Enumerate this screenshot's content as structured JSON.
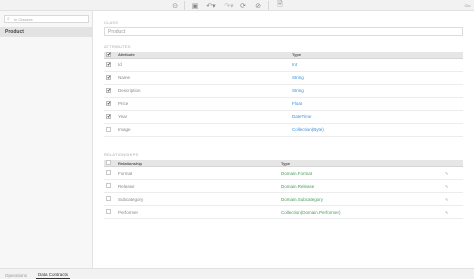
{
  "toolbar": {
    "buttons": [
      {
        "name": "refresh-icon",
        "glyph": "⊙"
      },
      {
        "name": "save-icon",
        "glyph": "▣"
      },
      {
        "name": "undo-icon",
        "glyph": "↶▾"
      },
      {
        "name": "redo-icon",
        "glyph": "↷▾"
      },
      {
        "name": "sync-icon",
        "glyph": "⟳"
      },
      {
        "name": "check-icon",
        "glyph": "⊘"
      },
      {
        "name": "document-icon",
        "glyph": "🗎"
      }
    ],
    "corner_label": "Clo"
  },
  "sidebar": {
    "filter_placeholder": "In Classes",
    "items": [
      {
        "label": "Product"
      }
    ]
  },
  "main": {
    "class_label": "CLASS",
    "class_name": "Product",
    "attributes_label": "ATTRIBUTES",
    "attributes_headers": [
      "Attribute",
      "Type"
    ],
    "attributes": [
      {
        "checked": true,
        "name": "Id",
        "type": "Int"
      },
      {
        "checked": true,
        "name": "Name",
        "type": "String"
      },
      {
        "checked": true,
        "name": "Description",
        "type": "String"
      },
      {
        "checked": true,
        "name": "Price",
        "type": "Float"
      },
      {
        "checked": true,
        "name": "Year",
        "type": "DateTime"
      },
      {
        "checked": false,
        "name": "Image",
        "type": "Collection(Byte)"
      }
    ],
    "relationships_label": "RELATIONSHIPS",
    "relationships_headers": [
      "Relationship",
      "Type"
    ],
    "relationships": [
      {
        "checked": false,
        "name": "Format",
        "type": "Domain.Format"
      },
      {
        "checked": false,
        "name": "Release",
        "type": "Domain.Release"
      },
      {
        "checked": false,
        "name": "Subcategory",
        "type": "Domain.Subcategory"
      },
      {
        "checked": false,
        "name": "Performer",
        "type": "Collection(Domain.Performer)"
      }
    ]
  },
  "bottom_tabs": [
    {
      "label": "Operations",
      "active": false
    },
    {
      "label": "Data Contracts",
      "active": true
    }
  ]
}
